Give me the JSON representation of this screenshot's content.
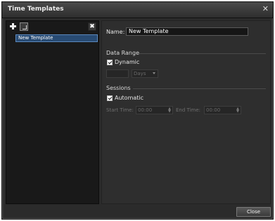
{
  "window": {
    "title": "Time Templates"
  },
  "left_panel": {
    "templates": [
      {
        "label": "New Template"
      }
    ],
    "buttons": {
      "add": "add",
      "duplicate": "duplicate",
      "delete": "delete"
    }
  },
  "right_panel": {
    "name_label": "Name:",
    "name_value": "New Template",
    "data_range": {
      "section_title": "Data Range",
      "dynamic_label": "Dynamic",
      "dynamic_checked": true,
      "days_count": "",
      "unit": "Days"
    },
    "sessions": {
      "section_title": "Sessions",
      "automatic_label": "Automatic",
      "automatic_checked": true,
      "start_label": "Start Time:",
      "start_value": "00:00",
      "end_label": "End Time:",
      "end_value": "00:00"
    }
  },
  "footer": {
    "close_label": "Close"
  },
  "colors": {
    "window_bg": "#2b2b2b",
    "list_bg": "#191919",
    "selection": "#284b73",
    "text": "#e6e6e6",
    "disabled_text": "#6e6e6e"
  }
}
